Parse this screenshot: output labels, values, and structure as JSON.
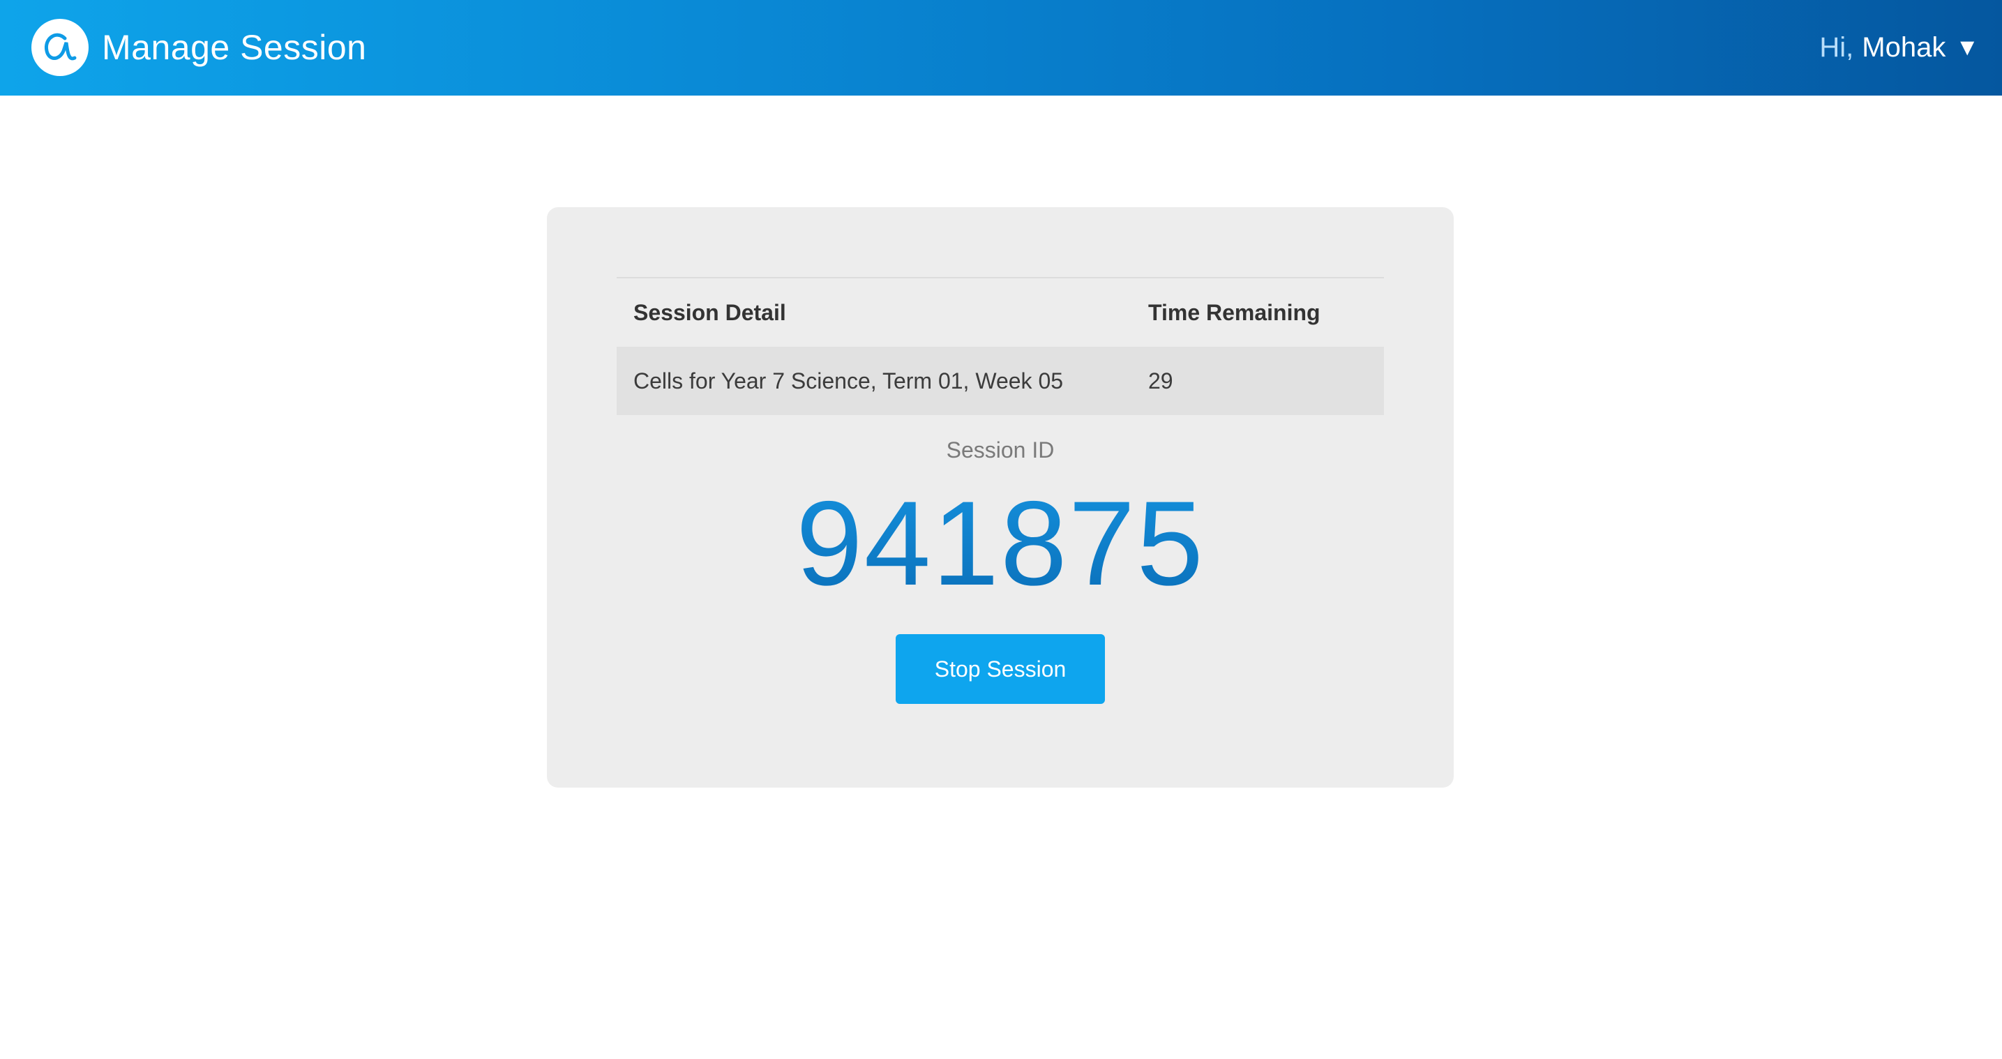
{
  "header": {
    "title": "Manage Session",
    "logo_icon": "alpha-icon",
    "greeting": "Hi,",
    "username": "Mohak",
    "caret": "▼"
  },
  "session_table": {
    "headers": [
      "Session Detail",
      "Time Remaining"
    ],
    "rows": [
      [
        "Cells for Year 7 Science, Term 01, Week 05",
        "29"
      ]
    ]
  },
  "session": {
    "id_label": "Session ID",
    "id_value": "941875",
    "stop_label": "Stop Session"
  },
  "colors": {
    "header_gradient_start": "#0ea4ea",
    "header_gradient_end": "#05579f",
    "accent": "#0ea5ee",
    "card_bg": "#ededed"
  }
}
